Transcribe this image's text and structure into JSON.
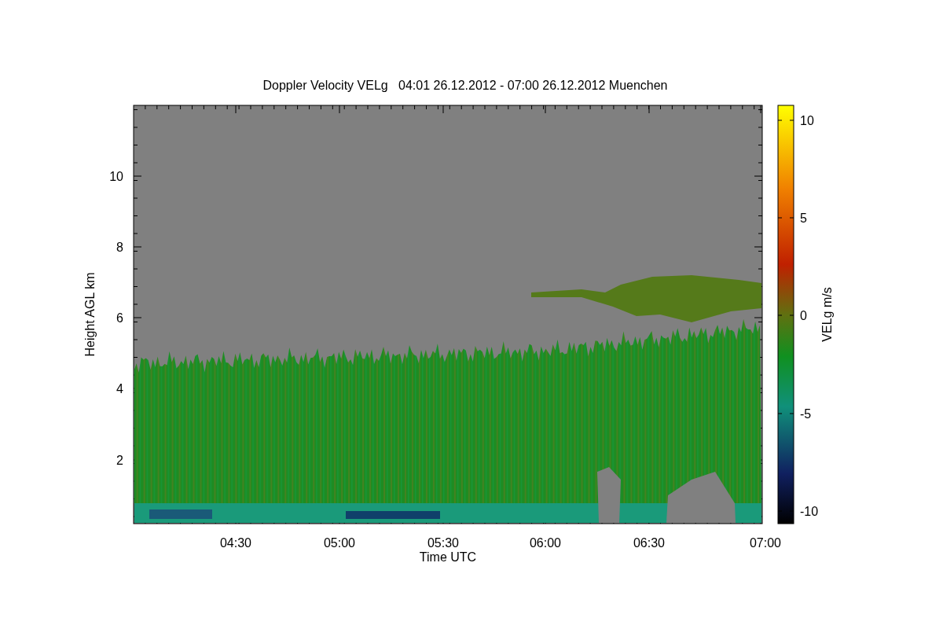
{
  "title": "Doppler Velocity VELg   04:01 26.12.2012 - 07:00 26.12.2012 Muenchen",
  "plot": {
    "xlabel": "Time UTC",
    "ylabel": "Height AGL km",
    "xticks": [
      "04:30",
      "05:00",
      "05:30",
      "06:00",
      "06:30",
      "07:00"
    ],
    "yticks": [
      "10",
      "8",
      "6",
      "4",
      "2"
    ]
  },
  "colorbar": {
    "label": "VELg m/s",
    "ticks": [
      "10",
      "5",
      "0",
      "-5",
      "-10"
    ]
  }
}
